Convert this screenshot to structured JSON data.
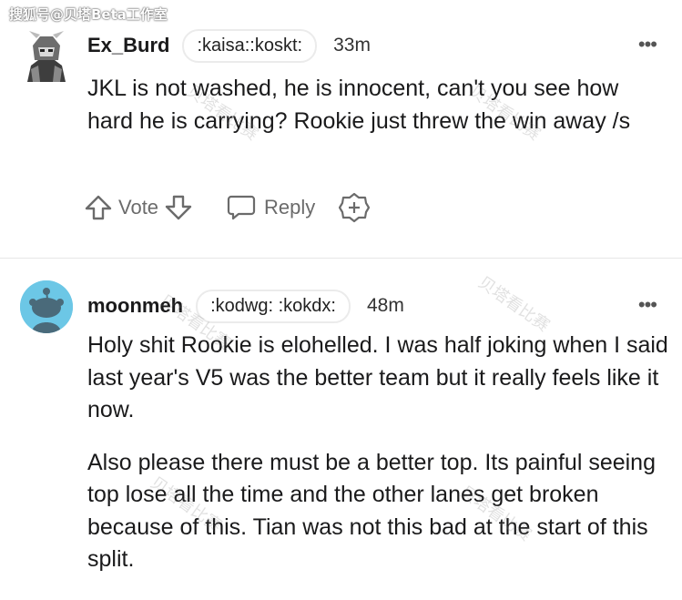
{
  "watermark": {
    "top_left": "搜狐号@贝塔Beta工作室",
    "overlay": "贝塔看比赛"
  },
  "comments": [
    {
      "username": "Ex_Burd",
      "flair": ":kaisa::koskt:",
      "time": "33m",
      "more": "•••",
      "paragraphs": [
        "JKL is not washed, he is innocent, can't you see how hard he is carrying? Rookie just threw the win away /s"
      ],
      "actions": {
        "vote": "Vote",
        "reply": "Reply"
      }
    },
    {
      "username": "moonmeh",
      "flair": ":kodwg: :kokdx:",
      "time": "48m",
      "more": "•••",
      "paragraphs": [
        "Holy shit Rookie is elohelled. I was half joking when I said last year's V5 was the better team but it really feels like it now.",
        "Also please there must be a better top. Its painful seeing top lose all the time and the other lanes get broken because of this. Tian was not this bad at the start of this split."
      ]
    }
  ]
}
